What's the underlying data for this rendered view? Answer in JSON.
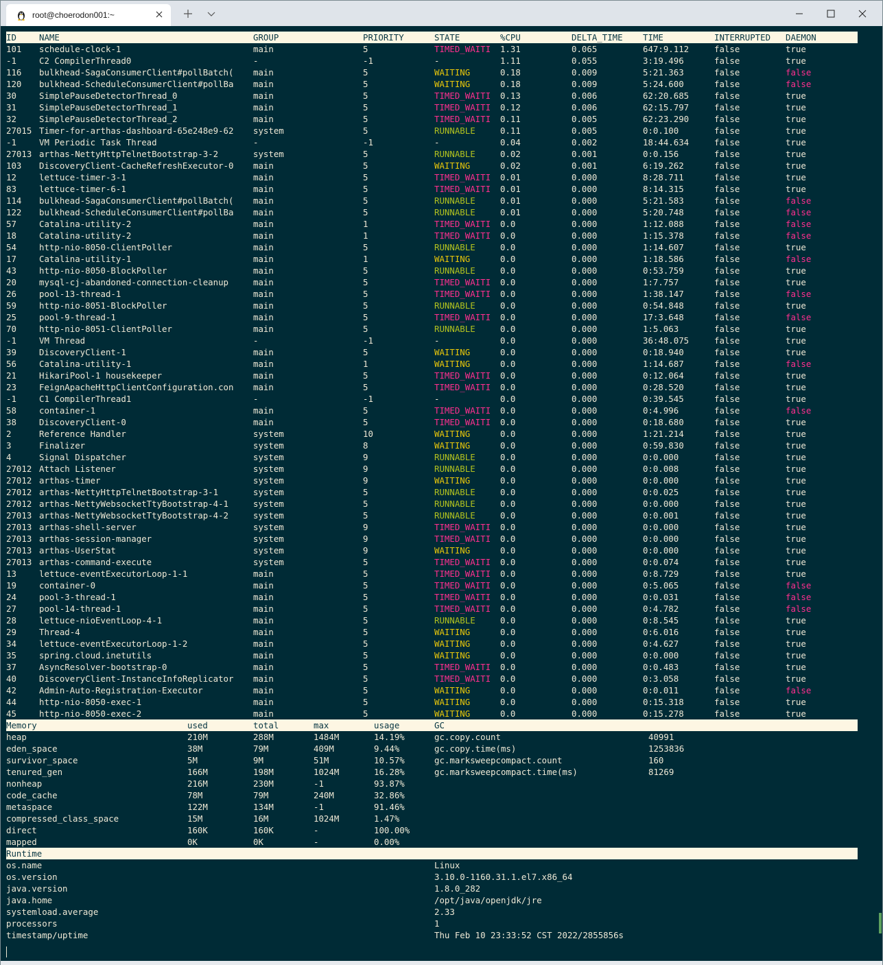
{
  "window": {
    "tab_title": "root@choerodon001:~",
    "tab_icon": "linux-penguin-icon",
    "buttons": [
      "new-tab",
      "tab-dropdown",
      "minimize",
      "maximize",
      "close"
    ]
  },
  "threads": {
    "columns": [
      "ID",
      "NAME",
      "GROUP",
      "PRIORITY",
      "STATE",
      "%CPU",
      "DELTA_TIME",
      "TIME",
      "INTERRUPTED",
      "DAEMON"
    ],
    "rows": [
      [
        "101",
        "schedule-clock-1",
        "main",
        "5",
        "TIMED_WAITI",
        "1.31",
        "0.065",
        "647:9.112",
        "false",
        "true"
      ],
      [
        "-1",
        "C2 CompilerThread0",
        "-",
        "-1",
        "-",
        "1.11",
        "0.055",
        "3:19.496",
        "false",
        "true"
      ],
      [
        "116",
        "bulkhead-SagaConsumerClient#pollBatch(",
        "main",
        "5",
        "WAITING",
        "0.18",
        "0.009",
        "5:21.363",
        "false",
        "false"
      ],
      [
        "120",
        "bulkhead-ScheduleConsumerClient#pollBa",
        "main",
        "5",
        "WAITING",
        "0.18",
        "0.009",
        "5:24.600",
        "false",
        "false"
      ],
      [
        "30",
        "SimplePauseDetectorThread_0",
        "main",
        "5",
        "TIMED_WAITI",
        "0.13",
        "0.006",
        "62:20.685",
        "false",
        "true"
      ],
      [
        "31",
        "SimplePauseDetectorThread_1",
        "main",
        "5",
        "TIMED_WAITI",
        "0.12",
        "0.006",
        "62:15.797",
        "false",
        "true"
      ],
      [
        "32",
        "SimplePauseDetectorThread_2",
        "main",
        "5",
        "TIMED_WAITI",
        "0.11",
        "0.005",
        "62:23.290",
        "false",
        "true"
      ],
      [
        "27015",
        "Timer-for-arthas-dashboard-65e248e9-62",
        "system",
        "5",
        "RUNNABLE",
        "0.11",
        "0.005",
        "0:0.100",
        "false",
        "true"
      ],
      [
        "-1",
        "VM Periodic Task Thread",
        "-",
        "-1",
        "-",
        "0.04",
        "0.002",
        "18:44.634",
        "false",
        "true"
      ],
      [
        "27013",
        "arthas-NettyHttpTelnetBootstrap-3-2",
        "system",
        "5",
        "RUNNABLE",
        "0.02",
        "0.001",
        "0:0.156",
        "false",
        "true"
      ],
      [
        "103",
        "DiscoveryClient-CacheRefreshExecutor-0",
        "main",
        "5",
        "WAITING",
        "0.02",
        "0.001",
        "6:19.262",
        "false",
        "true"
      ],
      [
        "12",
        "lettuce-timer-3-1",
        "main",
        "5",
        "TIMED_WAITI",
        "0.01",
        "0.000",
        "8:28.711",
        "false",
        "true"
      ],
      [
        "83",
        "lettuce-timer-6-1",
        "main",
        "5",
        "TIMED_WAITI",
        "0.01",
        "0.000",
        "8:14.315",
        "false",
        "true"
      ],
      [
        "114",
        "bulkhead-SagaConsumerClient#pollBatch(",
        "main",
        "5",
        "RUNNABLE",
        "0.01",
        "0.000",
        "5:21.583",
        "false",
        "false"
      ],
      [
        "122",
        "bulkhead-ScheduleConsumerClient#pollBa",
        "main",
        "5",
        "RUNNABLE",
        "0.01",
        "0.000",
        "5:20.748",
        "false",
        "false"
      ],
      [
        "57",
        "Catalina-utility-2",
        "main",
        "1",
        "TIMED_WAITI",
        "0.0",
        "0.000",
        "1:12.088",
        "false",
        "false"
      ],
      [
        "18",
        "Catalina-utility-2",
        "main",
        "1",
        "TIMED_WAITI",
        "0.0",
        "0.000",
        "1:15.378",
        "false",
        "false"
      ],
      [
        "54",
        "http-nio-8050-ClientPoller",
        "main",
        "5",
        "RUNNABLE",
        "0.0",
        "0.000",
        "1:14.607",
        "false",
        "true"
      ],
      [
        "17",
        "Catalina-utility-1",
        "main",
        "1",
        "WAITING",
        "0.0",
        "0.000",
        "1:18.586",
        "false",
        "false"
      ],
      [
        "43",
        "http-nio-8050-BlockPoller",
        "main",
        "5",
        "RUNNABLE",
        "0.0",
        "0.000",
        "0:53.759",
        "false",
        "true"
      ],
      [
        "20",
        "mysql-cj-abandoned-connection-cleanup",
        "main",
        "5",
        "TIMED_WAITI",
        "0.0",
        "0.000",
        "1:7.757",
        "false",
        "true"
      ],
      [
        "26",
        "pool-13-thread-1",
        "main",
        "5",
        "TIMED_WAITI",
        "0.0",
        "0.000",
        "1:38.147",
        "false",
        "false"
      ],
      [
        "59",
        "http-nio-8051-BlockPoller",
        "main",
        "5",
        "RUNNABLE",
        "0.0",
        "0.000",
        "0:54.848",
        "false",
        "true"
      ],
      [
        "25",
        "pool-9-thread-1",
        "main",
        "5",
        "TIMED_WAITI",
        "0.0",
        "0.000",
        "17:3.648",
        "false",
        "false"
      ],
      [
        "70",
        "http-nio-8051-ClientPoller",
        "main",
        "5",
        "RUNNABLE",
        "0.0",
        "0.000",
        "1:5.063",
        "false",
        "true"
      ],
      [
        "-1",
        "VM Thread",
        "-",
        "-1",
        "-",
        "0.0",
        "0.000",
        "36:48.075",
        "false",
        "true"
      ],
      [
        "39",
        "DiscoveryClient-1",
        "main",
        "5",
        "WAITING",
        "0.0",
        "0.000",
        "0:18.940",
        "false",
        "true"
      ],
      [
        "56",
        "Catalina-utility-1",
        "main",
        "1",
        "WAITING",
        "0.0",
        "0.000",
        "1:14.687",
        "false",
        "false"
      ],
      [
        "21",
        "HikariPool-1 housekeeper",
        "main",
        "5",
        "TIMED_WAITI",
        "0.0",
        "0.000",
        "0:12.064",
        "false",
        "true"
      ],
      [
        "23",
        "FeignApacheHttpClientConfiguration.con",
        "main",
        "5",
        "TIMED_WAITI",
        "0.0",
        "0.000",
        "0:28.520",
        "false",
        "true"
      ],
      [
        "-1",
        "C1 CompilerThread1",
        "-",
        "-1",
        "-",
        "0.0",
        "0.000",
        "0:39.545",
        "false",
        "true"
      ],
      [
        "58",
        "container-1",
        "main",
        "5",
        "TIMED_WAITI",
        "0.0",
        "0.000",
        "0:4.996",
        "false",
        "false"
      ],
      [
        "38",
        "DiscoveryClient-0",
        "main",
        "5",
        "TIMED_WAITI",
        "0.0",
        "0.000",
        "0:18.680",
        "false",
        "true"
      ],
      [
        "2",
        "Reference Handler",
        "system",
        "10",
        "WAITING",
        "0.0",
        "0.000",
        "1:21.214",
        "false",
        "true"
      ],
      [
        "3",
        "Finalizer",
        "system",
        "8",
        "WAITING",
        "0.0",
        "0.000",
        "0:59.830",
        "false",
        "true"
      ],
      [
        "4",
        "Signal Dispatcher",
        "system",
        "9",
        "RUNNABLE",
        "0.0",
        "0.000",
        "0:0.000",
        "false",
        "true"
      ],
      [
        "27012",
        "Attach Listener",
        "system",
        "9",
        "RUNNABLE",
        "0.0",
        "0.000",
        "0:0.008",
        "false",
        "true"
      ],
      [
        "27012",
        "arthas-timer",
        "system",
        "9",
        "WAITING",
        "0.0",
        "0.000",
        "0:0.000",
        "false",
        "true"
      ],
      [
        "27012",
        "arthas-NettyHttpTelnetBootstrap-3-1",
        "system",
        "5",
        "RUNNABLE",
        "0.0",
        "0.000",
        "0:0.025",
        "false",
        "true"
      ],
      [
        "27012",
        "arthas-NettyWebsocketTtyBootstrap-4-1",
        "system",
        "5",
        "RUNNABLE",
        "0.0",
        "0.000",
        "0:0.000",
        "false",
        "true"
      ],
      [
        "27013",
        "arthas-NettyWebsocketTtyBootstrap-4-2",
        "system",
        "5",
        "RUNNABLE",
        "0.0",
        "0.000",
        "0:0.001",
        "false",
        "true"
      ],
      [
        "27013",
        "arthas-shell-server",
        "system",
        "9",
        "TIMED_WAITI",
        "0.0",
        "0.000",
        "0:0.000",
        "false",
        "true"
      ],
      [
        "27013",
        "arthas-session-manager",
        "system",
        "9",
        "TIMED_WAITI",
        "0.0",
        "0.000",
        "0:0.000",
        "false",
        "true"
      ],
      [
        "27013",
        "arthas-UserStat",
        "system",
        "9",
        "WAITING",
        "0.0",
        "0.000",
        "0:0.000",
        "false",
        "true"
      ],
      [
        "27013",
        "arthas-command-execute",
        "system",
        "5",
        "TIMED_WAITI",
        "0.0",
        "0.000",
        "0:0.074",
        "false",
        "true"
      ],
      [
        "13",
        "lettuce-eventExecutorLoop-1-1",
        "main",
        "5",
        "TIMED_WAITI",
        "0.0",
        "0.000",
        "0:8.729",
        "false",
        "true"
      ],
      [
        "19",
        "container-0",
        "main",
        "5",
        "TIMED_WAITI",
        "0.0",
        "0.000",
        "0:5.065",
        "false",
        "false"
      ],
      [
        "24",
        "pool-3-thread-1",
        "main",
        "5",
        "TIMED_WAITI",
        "0.0",
        "0.000",
        "0:0.031",
        "false",
        "false"
      ],
      [
        "27",
        "pool-14-thread-1",
        "main",
        "5",
        "TIMED_WAITI",
        "0.0",
        "0.000",
        "0:4.782",
        "false",
        "false"
      ],
      [
        "28",
        "lettuce-nioEventLoop-4-1",
        "main",
        "5",
        "RUNNABLE",
        "0.0",
        "0.000",
        "0:8.545",
        "false",
        "true"
      ],
      [
        "29",
        "Thread-4",
        "main",
        "5",
        "WAITING",
        "0.0",
        "0.000",
        "0:6.016",
        "false",
        "true"
      ],
      [
        "34",
        "lettuce-eventExecutorLoop-1-2",
        "main",
        "5",
        "WAITING",
        "0.0",
        "0.000",
        "0:4.627",
        "false",
        "true"
      ],
      [
        "35",
        "spring.cloud.inetutils",
        "main",
        "5",
        "WAITING",
        "0.0",
        "0.000",
        "0:0.000",
        "false",
        "true"
      ],
      [
        "37",
        "AsyncResolver-bootstrap-0",
        "main",
        "5",
        "TIMED_WAITI",
        "0.0",
        "0.000",
        "0:0.483",
        "false",
        "true"
      ],
      [
        "40",
        "DiscoveryClient-InstanceInfoReplicator",
        "main",
        "5",
        "TIMED_WAITI",
        "0.0",
        "0.000",
        "0:3.058",
        "false",
        "true"
      ],
      [
        "42",
        "Admin-Auto-Registration-Executor",
        "main",
        "5",
        "WAITING",
        "0.0",
        "0.000",
        "0:0.011",
        "false",
        "false"
      ],
      [
        "44",
        "http-nio-8050-exec-1",
        "main",
        "5",
        "WAITING",
        "0.0",
        "0.000",
        "0:15.318",
        "false",
        "true"
      ],
      [
        "45",
        "http-nio-8050-exec-2",
        "main",
        "5",
        "WAITING",
        "0.0",
        "0.000",
        "0:15.278",
        "false",
        "true"
      ]
    ]
  },
  "memory": {
    "columns": [
      "Memory",
      "used",
      "total",
      "max",
      "usage"
    ],
    "rows": [
      [
        "heap",
        "210M",
        "288M",
        "1484M",
        "14.19%"
      ],
      [
        "eden_space",
        "38M",
        "79M",
        "409M",
        "9.44%"
      ],
      [
        "survivor_space",
        "5M",
        "9M",
        "51M",
        "10.57%"
      ],
      [
        "tenured_gen",
        "166M",
        "198M",
        "1024M",
        "16.28%"
      ],
      [
        "nonheap",
        "216M",
        "230M",
        "-1",
        "93.87%"
      ],
      [
        "code_cache",
        "78M",
        "79M",
        "240M",
        "32.86%"
      ],
      [
        "metaspace",
        "122M",
        "134M",
        "-1",
        "91.46%"
      ],
      [
        "compressed_class_space",
        "15M",
        "16M",
        "1024M",
        "1.47%"
      ],
      [
        "direct",
        "160K",
        "160K",
        "-",
        "100.00%"
      ],
      [
        "mapped",
        "0K",
        "0K",
        "-",
        "0.00%"
      ]
    ]
  },
  "gc": {
    "title": "GC",
    "rows": [
      [
        "gc.copy.count",
        "40991"
      ],
      [
        "gc.copy.time(ms)",
        "1253836"
      ],
      [
        "gc.marksweepcompact.count",
        "160"
      ],
      [
        "gc.marksweepcompact.time(ms)",
        "81269"
      ]
    ]
  },
  "runtime": {
    "title": "Runtime",
    "rows": [
      [
        "os.name",
        "Linux"
      ],
      [
        "os.version",
        "3.10.0-1160.31.1.el7.x86_64"
      ],
      [
        "java.version",
        "1.8.0_282"
      ],
      [
        "java.home",
        "/opt/java/openjdk/jre"
      ],
      [
        "systemload.average",
        "2.33"
      ],
      [
        "processors",
        "1"
      ],
      [
        "timestamp/uptime",
        "Thu Feb 10 23:33:52 CST 2022/2855856s"
      ]
    ]
  }
}
